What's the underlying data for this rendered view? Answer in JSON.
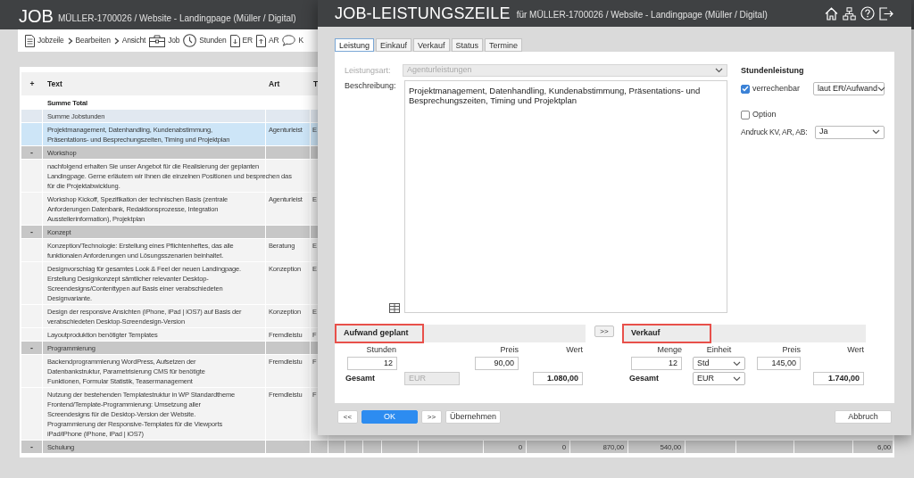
{
  "app": {
    "title": "JOB",
    "subtitle": "MÜLLER-1700026 / Website - Landingpage (Müller / Digital)"
  },
  "toolbar": [
    {
      "kind": "document",
      "label": "Jobzeile"
    },
    {
      "kind": "chevron",
      "label": "Bearbeiten"
    },
    {
      "kind": "chevron",
      "label": "Ansicht"
    },
    {
      "kind": "briefcase",
      "label": "Job"
    },
    {
      "kind": "clock",
      "label": "Stunden"
    },
    {
      "kind": "download",
      "label": "ER"
    },
    {
      "kind": "upload",
      "label": "AR"
    },
    {
      "kind": "speech",
      "label": "K"
    }
  ],
  "table": {
    "columns": [
      "+",
      "Text",
      "Art",
      "T"
    ],
    "rows": [
      {
        "kind": "total",
        "text": "Summe Total",
        "selected": false
      },
      {
        "kind": "subtotal",
        "text": "Summe Jobstunden",
        "selected": false
      },
      {
        "kind": "item",
        "text": "Projektmanagement, Datenhandling, Kundenabstimmung,\nPräsentations- und Besprechungszeiten, Timing und Projektplan",
        "art": "Agenturleist",
        "column_3": "E",
        "selected": true
      },
      {
        "kind": "group",
        "toggle": "-",
        "text": "Workshop",
        "selected": false
      },
      {
        "kind": "item",
        "text": "nachfolgend erhalten Sie unser Angebot für die Realisierung der geplanten\nLandingpage. Gerne erläutern wir Ihnen die einzelnen Positionen und besprechen das\nfür die Projektabwicklung.",
        "selected": false
      },
      {
        "kind": "item",
        "text": "Workshop Kickoff, Spezifikation der technischen Basis (zentrale\nAnforderungen Datenbank, Redaktionsprozesse, Integration\nAusstellerinformation), Projektplan",
        "art": "Agenturleist",
        "column_3": "E",
        "selected": false
      },
      {
        "kind": "group",
        "toggle": "-",
        "text": "Konzept",
        "selected": false
      },
      {
        "kind": "item",
        "text": "Konzeption/Technologie: Erstellung eines Pflichtenheftes, das alle\nfunktionalen Anforderungen und Lösungsszenarien beinhaltet.",
        "art": "Beratung",
        "column_3": "E",
        "selected": false
      },
      {
        "kind": "item",
        "text": "Designvorschlag für gesamtes Look & Feel der neuen Landingpage.\nErstellung Designkonzept sämtlicher relevanter Desktop-\nScreendesigns/Contenttypen auf Basis einer verabschiedeten\nDesignvariante.",
        "art": "Konzeption",
        "column_3": "E",
        "selected": false
      },
      {
        "kind": "item",
        "text": "Design der responsive Ansichten (iPhone, iPad | iOS7) auf Basis der\nverabschiedeten Desktop-Screendesign-Version",
        "art": "Konzeption",
        "column_3": "E",
        "selected": false
      },
      {
        "kind": "item",
        "text": "Layoutproduktion benötigter Templates",
        "art": "Fremdleistu",
        "column_3": "F",
        "selected": false
      },
      {
        "kind": "group",
        "toggle": "-",
        "text": "Programmierung",
        "selected": false
      },
      {
        "kind": "item",
        "text": "Backendprogrammierung WordPress, Aufsetzen der\nDatenbankstruktur, Parametrisierung CMS für benötigte\nFunktionen, Formular Statistik, Teasermanagement",
        "art": "Fremdleistu",
        "column_3": "F",
        "selected": false
      },
      {
        "kind": "item",
        "text": "Nutzung der bestehenden Templatestruktur in WP Standardtheme\nFrontend/Template-Programmierung: Umsetzung aller\nScreendesigns für die Desktop-Version der Website.\nProgrammierung der Responsive-Templates für die Viewports\niPad/iPhone (iPhone, iPad | iOS7)",
        "art": "Fremdleistu",
        "column_3": "F",
        "selected": false
      },
      {
        "kind": "group",
        "toggle": "-",
        "text": "Schulung",
        "totals": [
          "0",
          "0",
          "870,00",
          "540,00",
          "6,00"
        ],
        "selected": false
      }
    ]
  },
  "dialog": {
    "title": "JOB-LEISTUNGSZEILE",
    "subtitle": "für MÜLLER-1700026 / Website - Landingpage (Müller / Digital)",
    "tabs": [
      {
        "label": "Leistung",
        "selected": true
      },
      {
        "label": "Einkauf",
        "selected": false
      },
      {
        "label": "Verkauf",
        "selected": false
      },
      {
        "label": "Status",
        "selected": false
      },
      {
        "label": "Termine",
        "selected": false
      }
    ],
    "leistungsart": {
      "label": "Leistungsart:",
      "value": "Agenturleistungen",
      "disabled": true
    },
    "beschreibung": {
      "label": "Beschreibung:",
      "value": "Projektmanagement, Datenhandling, Kundenabstimmung, Präsentations- und Besprechungszeiten, Timing und Projektplan"
    },
    "stundenleistung": {
      "heading": "Stundenleistung",
      "verrechenbar": {
        "label": "verrechenbar",
        "checked": true
      },
      "abrechnung": "laut ER/Aufwand",
      "option": {
        "label": "Option",
        "checked": false
      },
      "andruck": {
        "label": "Andruck KV, AR, AB:",
        "value": "Ja"
      }
    },
    "aufwand": {
      "heading": "Aufwand geplant",
      "highlighted": true,
      "columns": [
        "Stunden",
        "Preis",
        "Wert"
      ],
      "stunden": "12",
      "preis": "90,00",
      "gesamt_label": "Gesamt",
      "currency": {
        "value": "EUR",
        "disabled": true
      },
      "total": "1.080,00"
    },
    "transfer_button": ">>",
    "verkauf": {
      "heading": "Verkauf",
      "highlighted": true,
      "columns": [
        "Menge",
        "Einheit",
        "Preis",
        "Wert"
      ],
      "menge": "12",
      "einheit": "Std",
      "preis": "145,00",
      "gesamt_label": "Gesamt",
      "currency": {
        "value": "EUR",
        "disabled": false
      },
      "total": "1.740,00"
    },
    "buttons": [
      {
        "kind": "nav",
        "label": "<<"
      },
      {
        "kind": "primary",
        "label": "OK"
      },
      {
        "kind": "nav",
        "label": ">>"
      },
      {
        "kind": "default",
        "label": "Übernehmen"
      },
      {
        "kind": "cancel",
        "label": "Abbruch"
      }
    ]
  }
}
